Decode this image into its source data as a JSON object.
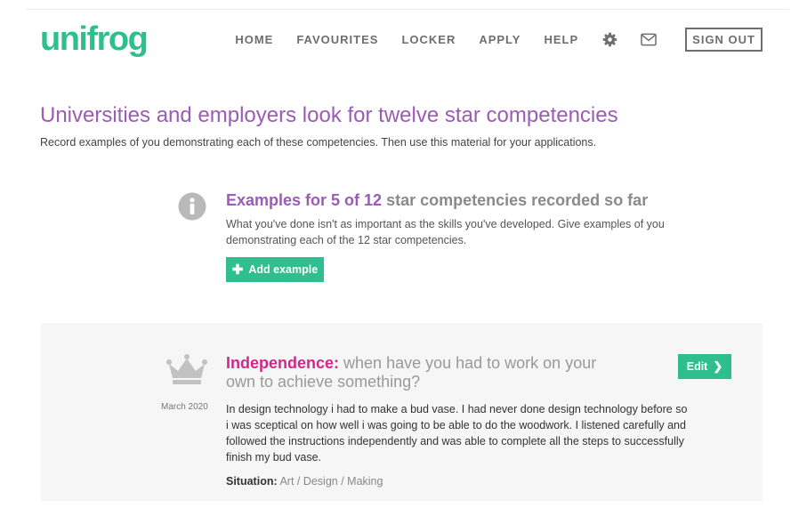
{
  "brand": {
    "logo_text": "unifrog",
    "accent": "#2fbf8f",
    "purple": "#9a5cb4",
    "pink": "#d0298a"
  },
  "nav": {
    "links": [
      "HOME",
      "FAVOURITES",
      "LOCKER",
      "APPLY",
      "HELP"
    ],
    "icons": [
      "gear-icon",
      "mail-icon"
    ],
    "signout_label": "SIGN OUT"
  },
  "page": {
    "title": "Universities and employers look for twelve star competencies",
    "subtitle": "Record examples of you demonstrating each of these competencies. Then use this material for your applications."
  },
  "progress": {
    "prefix": "Examples for ",
    "count_text": "5 of 12",
    "suffix": " star competencies recorded so far",
    "recorded": 5,
    "total": 12,
    "description": "What you've done isn't as important as the skills you've developed. Give examples of you demonstrating each of the 12 star competencies.",
    "add_button_label": "Add example",
    "icon": "info-icon"
  },
  "example": {
    "icon": "crown-icon",
    "date": "March 2020",
    "competency": "Independence:",
    "question": " when have you had to work on your own to achieve something?",
    "edit_label": "Edit",
    "story": "In design technology i had to make a bud vase. I had never done design technology before so i was sceptical on how well i was going to be able to do the woodwork. I listened carefully and followed the instructions independently and was able to complete all the steps to successfully finish my bud vase.",
    "situation_label": "Situation:",
    "situation_value": "Art / Design / Making"
  }
}
